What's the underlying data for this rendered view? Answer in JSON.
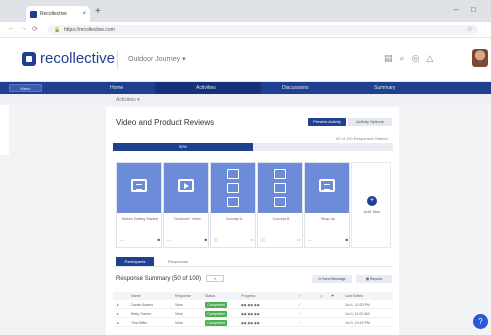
{
  "browser": {
    "tab_title": "Recollective",
    "url": "https://recollective.com"
  },
  "app": {
    "logo_text": "recollective",
    "project_name": "Outdoor Journey"
  },
  "nav": {
    "menu_label": "Menu",
    "items": [
      "Home",
      "Activities",
      "Discussions",
      "Summary"
    ],
    "active": "Activities"
  },
  "breadcrumb": "Activities",
  "activity": {
    "title": "Video and Product Reviews",
    "preview_label": "Preview Activity",
    "options_label": "Activity Options",
    "response_stats": "50 of 100 Responses Started",
    "progress_label": "50%",
    "progress_fraction": 0.5
  },
  "tasks": [
    {
      "label": "Before Getting Started",
      "icon": "screen-icon"
    },
    {
      "label": "\"Outdoors\" Video",
      "icon": "video-play-icon"
    },
    {
      "label": "Concept A",
      "icon": "checklist-icon"
    },
    {
      "label": "Concept B",
      "icon": "checklist-icon"
    },
    {
      "label": "Wrap Up",
      "icon": "screen-icon"
    }
  ],
  "add_task_label": "Add Task",
  "subtabs": [
    "Participants",
    "Responses"
  ],
  "summary": {
    "title": "Response Summary (50 of 100)",
    "send_message": "Send Message",
    "reports": "Reports"
  },
  "table": {
    "headers": [
      "Name",
      "Response",
      "Status",
      "Progress",
      "",
      "Last Edited"
    ],
    "rows": [
      {
        "name": "Daniel Adams",
        "response": "View",
        "status": "Completed",
        "last": "Jul 4, 10:30 PM"
      },
      {
        "name": "Betty Garner",
        "response": "View",
        "status": "Completed",
        "last": "Jul 4, 11:00 AM"
      },
      {
        "name": "Tina Miller",
        "response": "View",
        "status": "Completed",
        "last": "Jul 3, 10:15 PM"
      }
    ]
  },
  "help_label": "?"
}
